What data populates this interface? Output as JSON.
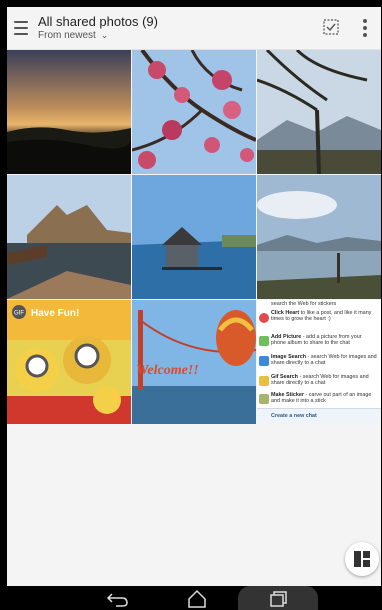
{
  "header": {
    "title": "All shared photos (9)",
    "sort_label": "From newest"
  },
  "photos": [
    {
      "label": "sunset-photo"
    },
    {
      "label": "plum-blossom-photo"
    },
    {
      "label": "mountain-tree-photo"
    },
    {
      "label": "harbor-castle-photo"
    },
    {
      "label": "lake-house-photo"
    },
    {
      "label": "lake-shore-photo"
    },
    {
      "label": "gif-minions-photo"
    },
    {
      "label": "bridge-balloon-photo"
    },
    {
      "label": "chat-help-screenshot"
    }
  ],
  "gif_tile": {
    "badge": "GIF",
    "caption": "Have Fun!"
  },
  "bridge_tile": {
    "caption": "Welcome!!"
  },
  "chat_help": {
    "top_text": "search the Web for stickers",
    "items": [
      {
        "title": "Click Heart",
        "rest": " to like a post, and like it many times to grow the heart :)"
      },
      {
        "title": "Add Picture",
        "rest": " - add a picture from your phone album to share to the chat"
      },
      {
        "title": "Image Search",
        "rest": " - search Web for images and share directly to a chat"
      },
      {
        "title": "Gif Search",
        "rest": " - search Web for images and share directly to a chat"
      },
      {
        "title": "Make Sticker",
        "rest": " - carve out part of an image and make it into a stick"
      }
    ],
    "bottom_text": "Create a new chat"
  },
  "colors": {
    "accent": "#2f87c7",
    "background": "#f4f4f4"
  }
}
